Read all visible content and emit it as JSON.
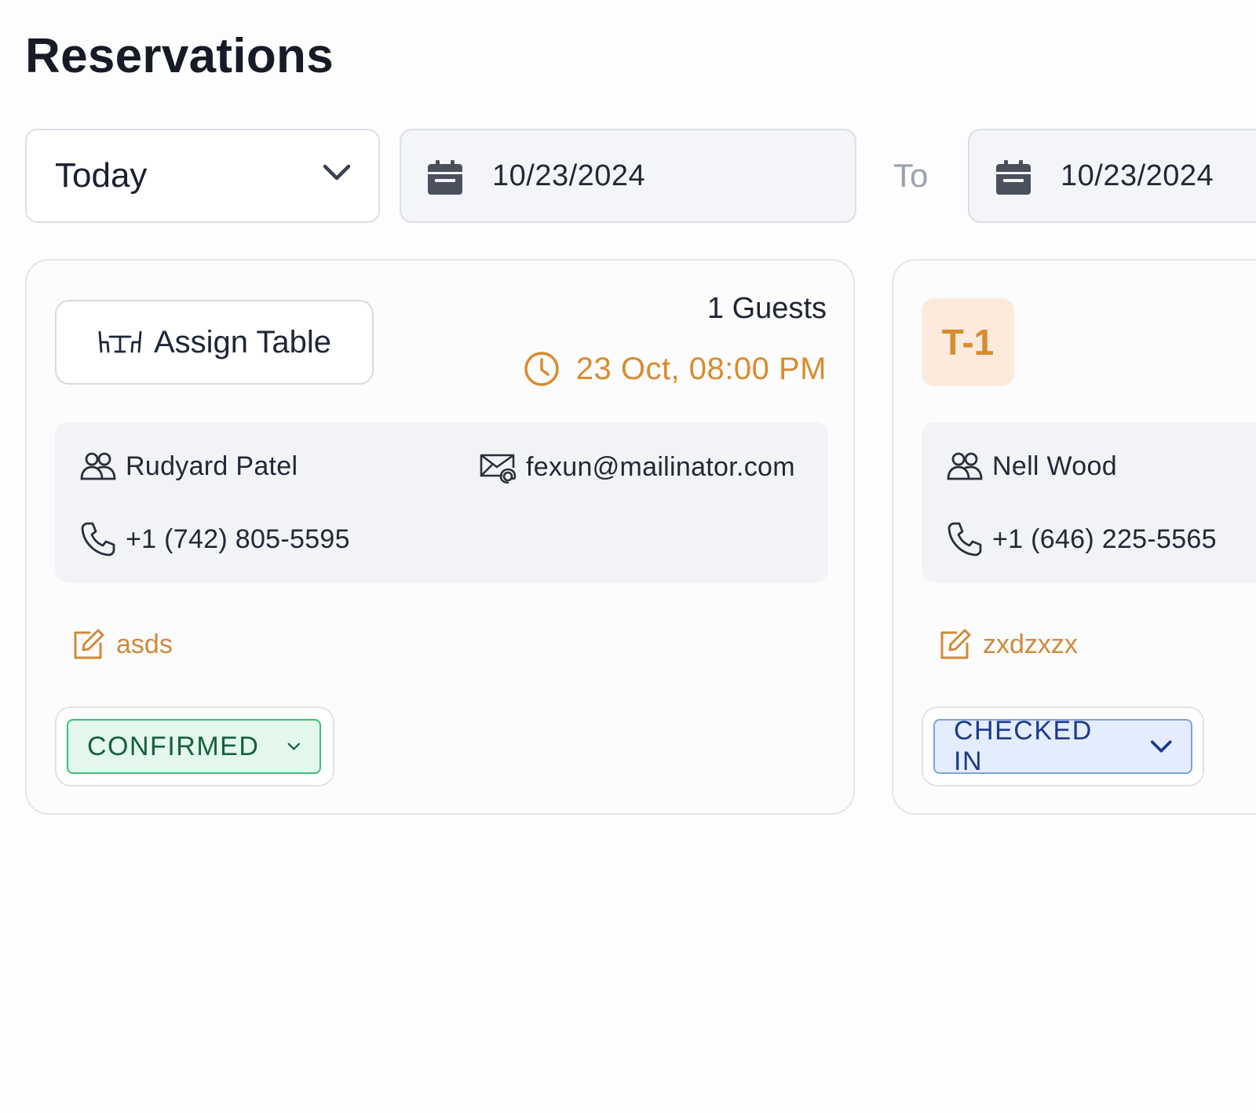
{
  "page": {
    "title": "Reservations"
  },
  "filters": {
    "range_value": "Today",
    "from_date": "10/23/2024",
    "to_label": "To",
    "to_date": "10/23/2024"
  },
  "reservations": [
    {
      "assign_label": "Assign Table",
      "guests": "1 Guests",
      "datetime": "23 Oct, 08:00 PM",
      "name": "Rudyard Patel",
      "email": "fexun@mailinator.com",
      "phone": "+1 (742) 805-5595",
      "note": "asds",
      "status": "CONFIRMED"
    },
    {
      "table": "T-1",
      "name": "Nell Wood",
      "phone": "+1 (646) 225-5565",
      "note": "zxdzxzx",
      "status": "CHECKED IN"
    }
  ],
  "colors": {
    "accent": "#d98b2e",
    "confirmed_bg": "#e3f7ec",
    "confirmed_border": "#3fbf79",
    "checked_bg": "#e4edfd",
    "checked_border": "#7fa2e6"
  },
  "icons": [
    "chevron-down-icon",
    "calendar-icon",
    "table-icon",
    "clock-icon",
    "users-icon",
    "mail-icon",
    "phone-icon",
    "edit-icon"
  ]
}
